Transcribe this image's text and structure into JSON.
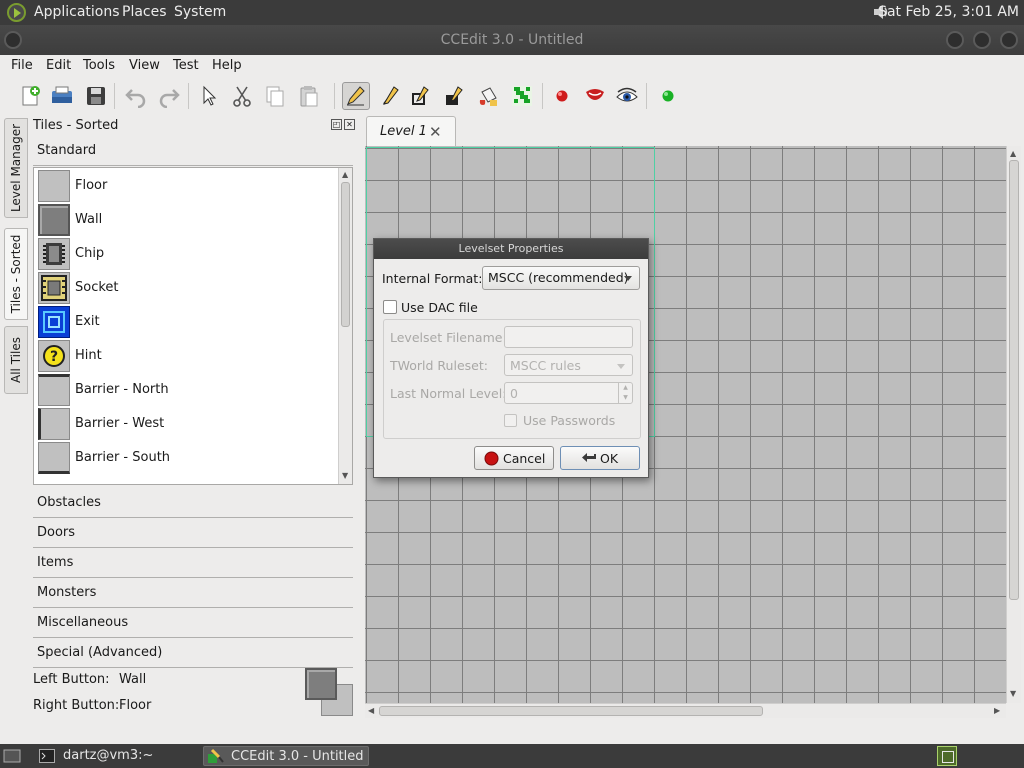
{
  "top_panel": {
    "menus": [
      "Applications",
      "Places",
      "System"
    ],
    "clock": "Sat Feb 25,  3:01 AM",
    "icons": {
      "logo": "distro-logo-icon",
      "volume": "volume-icon"
    }
  },
  "window": {
    "title": "CCEdit 3.0 - Untitled"
  },
  "menubar": {
    "items": [
      {
        "label": "File"
      },
      {
        "label": "Edit"
      },
      {
        "label": "Tools"
      },
      {
        "label": "View"
      },
      {
        "label": "Test"
      },
      {
        "label": "Help"
      }
    ]
  },
  "toolbar": {
    "icons": [
      "new-levelset-icon",
      "open-icon",
      "save-icon",
      "undo-icon",
      "redo-icon",
      "select-tool-icon",
      "cut-icon",
      "copy-icon",
      "paste-icon",
      "draw-pencil-icon",
      "line-tool-icon",
      "rectangle-tool-icon",
      "fill-tool-icon",
      "flood-fill-icon",
      "path-maker-icon",
      "trap-connect-icon",
      "cloner-connect-icon",
      "inspect-eye-icon",
      "play-test-icon"
    ],
    "active": "draw-pencil-icon"
  },
  "left_tabs": [
    "Level Manager",
    "Tiles - Sorted",
    "All Tiles"
  ],
  "dock": {
    "title": "Tiles - Sorted",
    "sections": [
      "Standard",
      "Obstacles",
      "Doors",
      "Items",
      "Monsters",
      "Miscellaneous",
      "Special (Advanced)"
    ],
    "tiles": [
      {
        "label": "Floor",
        "icon": "floor-tile-icon"
      },
      {
        "label": "Wall",
        "icon": "wall-tile-icon"
      },
      {
        "label": "Chip",
        "icon": "chip-tile-icon"
      },
      {
        "label": "Socket",
        "icon": "socket-tile-icon"
      },
      {
        "label": "Exit",
        "icon": "exit-tile-icon"
      },
      {
        "label": "Hint",
        "icon": "hint-tile-icon"
      },
      {
        "label": "Barrier - North",
        "icon": "barrier-north-icon"
      },
      {
        "label": "Barrier - West",
        "icon": "barrier-west-icon"
      },
      {
        "label": "Barrier - South",
        "icon": "barrier-south-icon"
      }
    ],
    "left_button": {
      "label": "Left Button:",
      "value": "Wall"
    },
    "right_button": {
      "label": "Right Button:",
      "value": "Floor"
    }
  },
  "document": {
    "tab_label": "Level 1"
  },
  "dialog": {
    "title": "Levelset Properties",
    "internal_format_label": "Internal Format:",
    "internal_format_value": "MSCC (recommended)",
    "use_dac_label": "Use DAC file",
    "levelset_filename_label": "Levelset Filename:",
    "levelset_filename_value": "",
    "tworld_ruleset_label": "TWorld Ruleset:",
    "tworld_ruleset_value": "MSCC rules",
    "last_normal_level_label": "Last Normal Level:",
    "last_normal_level_value": "0",
    "use_passwords_label": "Use Passwords",
    "cancel_label": "Cancel",
    "ok_label": "OK"
  },
  "taskbar": {
    "tasks": [
      {
        "label": "dartz@vm3:~",
        "icon": "terminal-icon"
      },
      {
        "label": "CCEdit 3.0 - Untitled",
        "icon": "ccedit-icon"
      }
    ]
  }
}
